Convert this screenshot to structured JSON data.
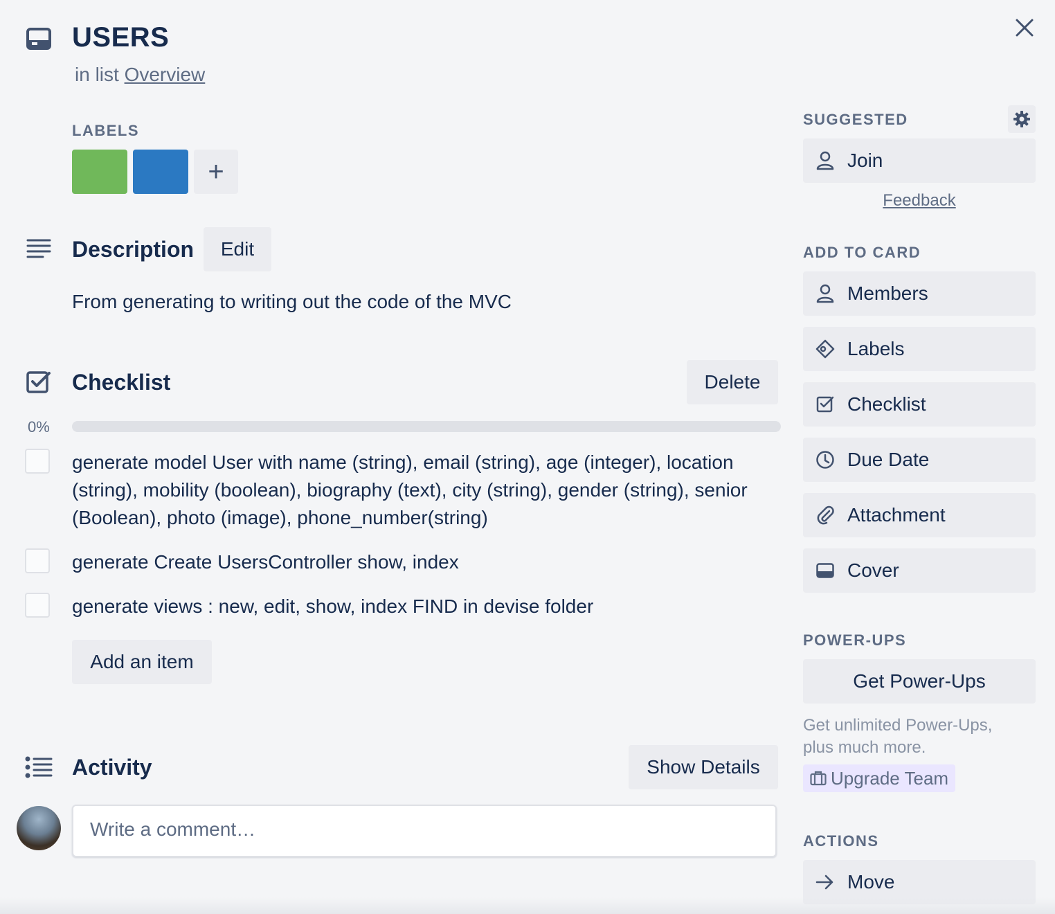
{
  "card": {
    "title": "USERS",
    "in_list_prefix": "in list",
    "list_name": "Overview"
  },
  "labels": {
    "heading": "LABELS",
    "chips": [
      {
        "name": "green",
        "color": "#70b85a"
      },
      {
        "name": "blue",
        "color": "#2b79c2"
      }
    ],
    "add": "+"
  },
  "description": {
    "heading": "Description",
    "edit_label": "Edit",
    "text": "From generating to writing out the code of the MVC"
  },
  "checklist": {
    "heading": "Checklist",
    "delete_label": "Delete",
    "progress_text": "0%",
    "progress_fraction": 0,
    "items": [
      {
        "text": "generate model User with name (string), email (string), age (integer), location (string), mobility (boolean), biography (text), city (string), gender (string), senior (Boolean), photo (image), phone_number(string)",
        "checked": false
      },
      {
        "text": "generate Create UsersController show, index",
        "checked": false
      },
      {
        "text": "generate views : new, edit, show, index FIND in devise folder",
        "checked": false
      }
    ],
    "add_item_label": "Add an item"
  },
  "activity": {
    "heading": "Activity",
    "show_details_label": "Show Details",
    "comment_placeholder": "Write a comment…"
  },
  "sidebar": {
    "suggested_heading": "SUGGESTED",
    "join_label": "Join",
    "feedback_label": "Feedback",
    "add_to_card_heading": "ADD TO CARD",
    "add_to_card": [
      {
        "label": "Members",
        "icon": "person-icon"
      },
      {
        "label": "Labels",
        "icon": "tag-icon"
      },
      {
        "label": "Checklist",
        "icon": "checkbox-icon"
      },
      {
        "label": "Due Date",
        "icon": "clock-icon"
      },
      {
        "label": "Attachment",
        "icon": "paperclip-icon"
      },
      {
        "label": "Cover",
        "icon": "cover-icon"
      }
    ],
    "powerups_heading": "POWER-UPS",
    "get_powerups_label": "Get Power-Ups",
    "promo_text": "Get unlimited Power-Ups, plus much more.",
    "upgrade_label": "Upgrade Team",
    "actions_heading": "ACTIONS",
    "move_label": "Move"
  },
  "colors": {
    "background": "#f4f5f7",
    "text": "#172b4d",
    "muted": "#5e6c84",
    "button": "#ebecf0"
  }
}
